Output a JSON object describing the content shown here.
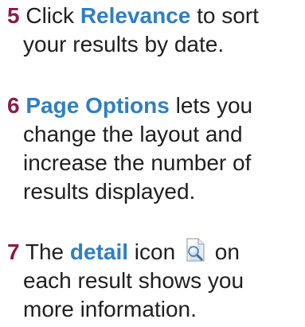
{
  "steps": [
    {
      "number": "5",
      "pre": " Click ",
      "keyword": "Relevance",
      "post": " to sort",
      "lines": [
        "your results by date."
      ]
    },
    {
      "number": "6",
      "pre": " ",
      "keyword": "Page Options",
      "post": " lets you",
      "lines": [
        "change the layout and",
        "increase the number of",
        "results displayed."
      ]
    },
    {
      "number": "7",
      "pre": " The ",
      "keyword": "detail",
      "mid": " icon ",
      "post": " on",
      "lines": [
        "each result shows you",
        "more information."
      ]
    }
  ],
  "colors": {
    "number": "#8b1a4a",
    "keyword": "#2f7fc1",
    "text": "#1f1f1f"
  },
  "icons": {
    "detail": "document-magnifier-icon"
  }
}
